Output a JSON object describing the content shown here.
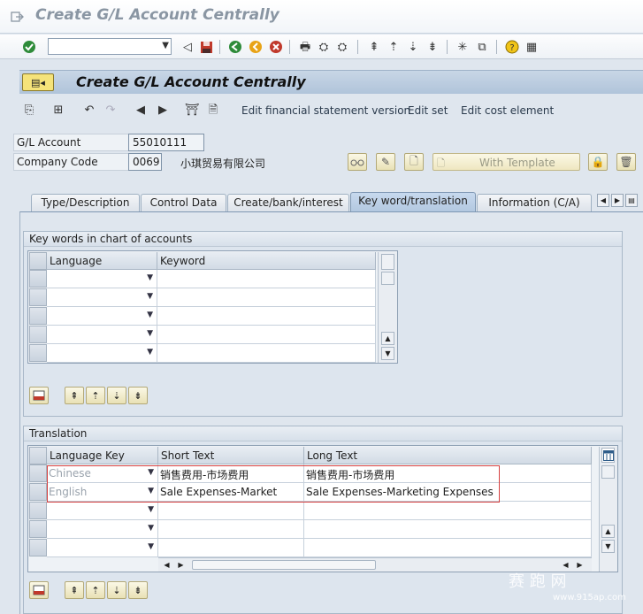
{
  "window": {
    "title": "Create G/L Account Centrally"
  },
  "systoolbar": {
    "command_field": "",
    "icons": [
      "enter-icon",
      "back-icon",
      "save-icon",
      "back-green-icon",
      "exit-icon",
      "cancel-icon",
      "print-icon",
      "find-icon",
      "find-next-icon",
      "first-page-icon",
      "prev-page-icon",
      "next-page-icon",
      "last-page-icon",
      "new-session-icon",
      "shortcut-icon",
      "help-icon",
      "layout-icon"
    ]
  },
  "screen": {
    "title": "Create G/L Account Centrally"
  },
  "apptoolbar": {
    "links": [
      "Edit financial statement version",
      "Edit set",
      "Edit cost element"
    ]
  },
  "header": {
    "gl_account_label": "G/L Account",
    "gl_account_value": "55010111",
    "company_code_label": "Company Code",
    "company_code_value": "0069",
    "company_name": "小琪贸易有限公司",
    "with_template_label": "With Template"
  },
  "tabs": [
    {
      "label": "Type/Description",
      "active": false
    },
    {
      "label": "Control Data",
      "active": false
    },
    {
      "label": "Create/bank/interest",
      "active": false
    },
    {
      "label": "Key word/translation",
      "active": true
    },
    {
      "label": "Information (C/A)",
      "active": false
    }
  ],
  "keywords": {
    "title": "Key words in chart of accounts",
    "columns": [
      "Language",
      "Keyword"
    ]
  },
  "translation": {
    "title": "Translation",
    "columns": [
      "Language Key",
      "Short Text",
      "Long Text"
    ],
    "rows": [
      {
        "language": "Chinese",
        "short": "销售费用-市场费用",
        "long": "销售费用-市场费用"
      },
      {
        "language": "English",
        "short": "Sale Expenses-Market",
        "long": "Sale Expenses-Marketing Expenses"
      },
      {
        "language": "",
        "short": "",
        "long": ""
      },
      {
        "language": "",
        "short": "",
        "long": ""
      },
      {
        "language": "",
        "short": "",
        "long": ""
      }
    ]
  },
  "watermark": {
    "line1": "赛 跑 网",
    "line2": "www.915ap.com"
  },
  "colors": {
    "highlight": "#d64040",
    "active_tab": "#b3c8e0",
    "title_bar": "#b0c4da"
  }
}
